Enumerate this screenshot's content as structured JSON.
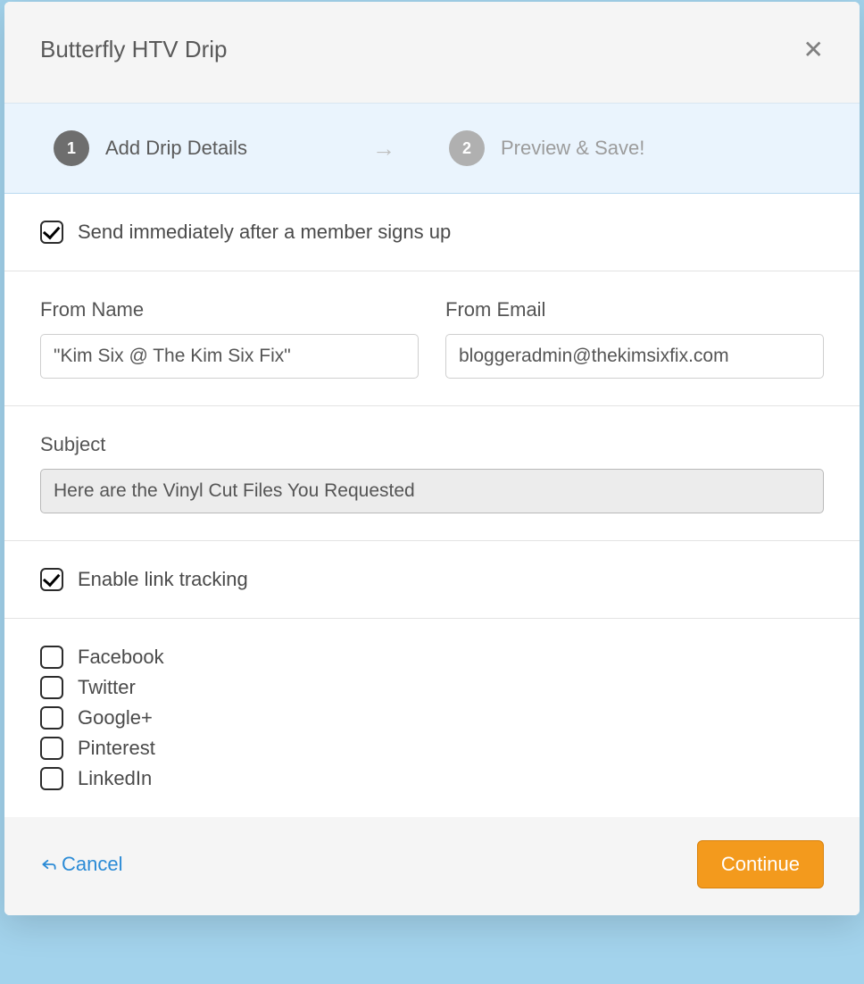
{
  "modal": {
    "title": "Butterfly HTV Drip"
  },
  "steps": {
    "step1": {
      "num": "1",
      "label": "Add Drip Details"
    },
    "step2": {
      "num": "2",
      "label": "Preview & Save!"
    }
  },
  "sendImmediately": {
    "label": "Send immediately after a member signs up",
    "checked": true
  },
  "fromName": {
    "label": "From Name",
    "value": "\"Kim Six @ The Kim Six Fix\""
  },
  "fromEmail": {
    "label": "From Email",
    "value": "bloggeradmin@thekimsixfix.com"
  },
  "subject": {
    "label": "Subject",
    "value": "Here are the Vinyl Cut Files You Requested"
  },
  "linkTracking": {
    "label": "Enable link tracking",
    "checked": true
  },
  "share": {
    "items": [
      {
        "label": "Facebook",
        "checked": false
      },
      {
        "label": "Twitter",
        "checked": false
      },
      {
        "label": "Google+",
        "checked": false
      },
      {
        "label": "Pinterest",
        "checked": false
      },
      {
        "label": "LinkedIn",
        "checked": false
      }
    ]
  },
  "footer": {
    "cancel": "Cancel",
    "continue": "Continue"
  }
}
